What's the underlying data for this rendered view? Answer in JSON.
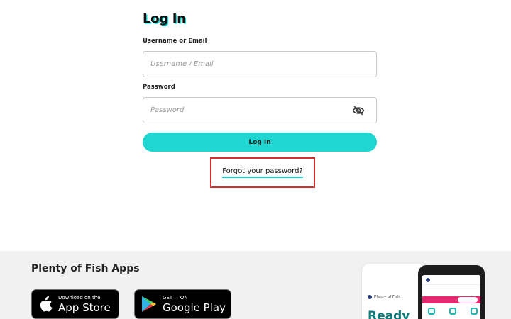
{
  "login": {
    "title": "Log In",
    "username_label": "Username or Email",
    "username_placeholder": "Username / Email",
    "password_label": "Password",
    "password_placeholder": "Password",
    "submit_label": "Log In",
    "forgot_label": "Forgot your password?"
  },
  "footer": {
    "title": "Plenty of Fish Apps",
    "app_store": {
      "small": "Download on the",
      "big": "App Store"
    },
    "google_play": {
      "small": "GET IT ON",
      "big": "Google Play"
    },
    "promo": {
      "brand": "Plenty of Fish",
      "headline": "Ready"
    }
  },
  "icons": {
    "password_toggle": "eye-off-icon",
    "apple": "apple-icon",
    "google_play": "google-play-icon"
  },
  "colors": {
    "accent": "#1fd6d0",
    "highlight_box": "#d32f2f",
    "footer_bg": "#f1f1f1",
    "promo_teal": "#0e7c7b",
    "promo_pink": "#e52a6f"
  }
}
